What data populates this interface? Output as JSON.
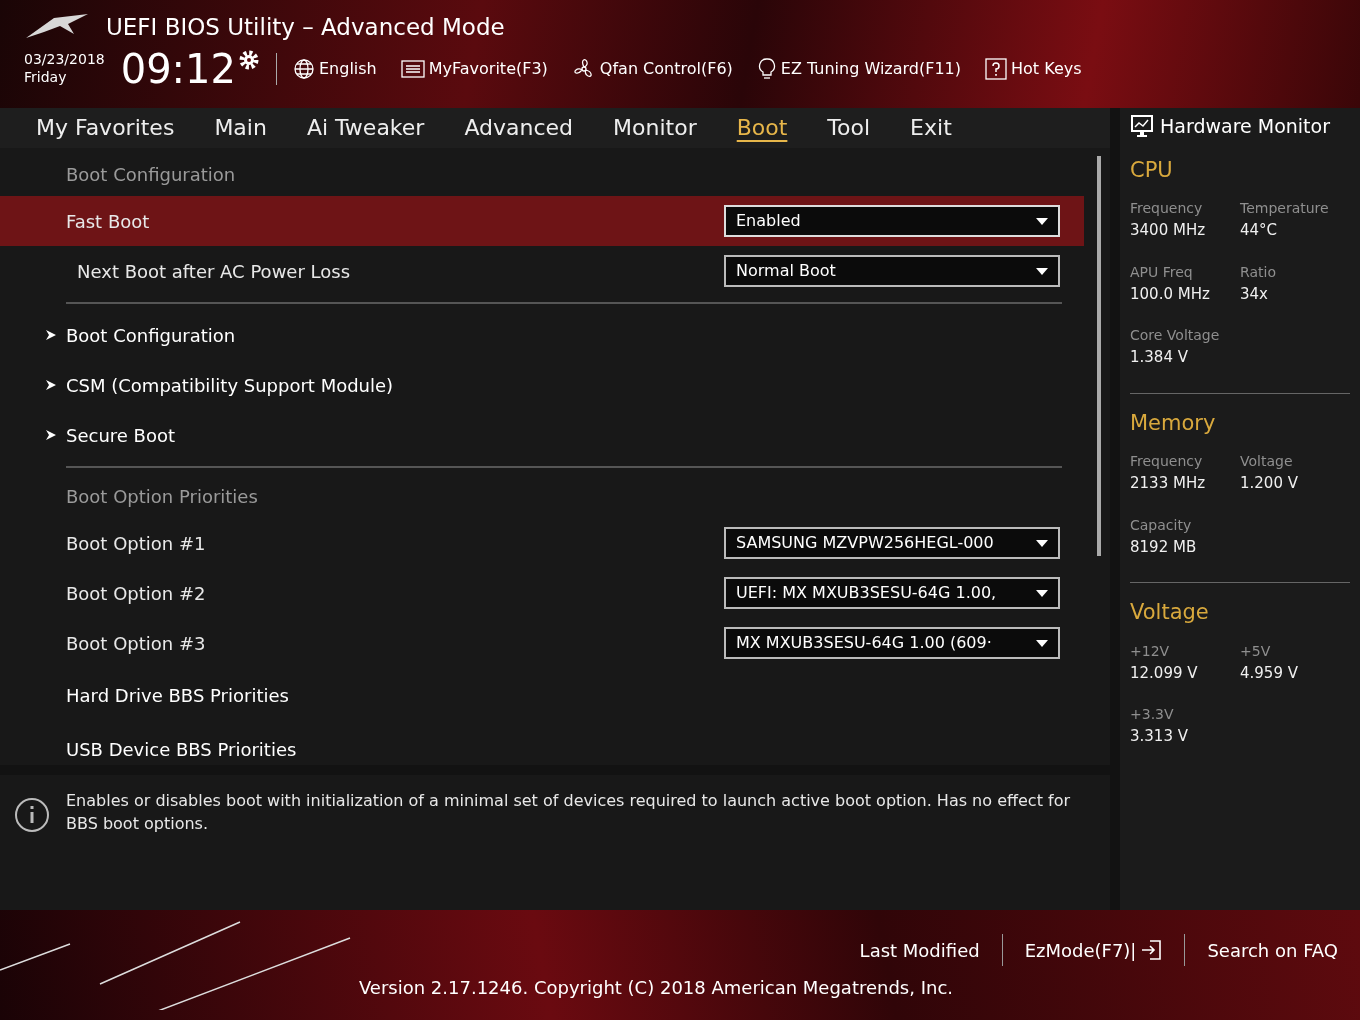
{
  "window": {
    "title": "UEFI BIOS Utility – Advanced Mode"
  },
  "header": {
    "date": "03/23/2018",
    "day": "Friday",
    "time": "09:12",
    "tools": [
      {
        "label": "English"
      },
      {
        "label": "MyFavorite(F3)"
      },
      {
        "label": "Qfan Control(F6)"
      },
      {
        "label": "EZ Tuning Wizard(F11)"
      },
      {
        "label": "Hot Keys"
      }
    ]
  },
  "tabs": [
    {
      "label": "My Favorites",
      "selected": false
    },
    {
      "label": "Main",
      "selected": false
    },
    {
      "label": "Ai Tweaker",
      "selected": false
    },
    {
      "label": "Advanced",
      "selected": false
    },
    {
      "label": "Monitor",
      "selected": false
    },
    {
      "label": "Boot",
      "selected": true
    },
    {
      "label": "Tool",
      "selected": false
    },
    {
      "label": "Exit",
      "selected": false
    }
  ],
  "items": [
    {
      "kind": "heading",
      "label": "Boot Configuration"
    },
    {
      "kind": "setting",
      "label": "Fast Boot",
      "value": "Enabled",
      "selected": true
    },
    {
      "kind": "setting",
      "label": "Next Boot after AC Power Loss",
      "value": "Normal Boot",
      "selected": false
    },
    {
      "kind": "divider"
    },
    {
      "kind": "submenu",
      "label": "Boot Configuration"
    },
    {
      "kind": "submenu",
      "label": "CSM (Compatibility Support Module)"
    },
    {
      "kind": "submenu",
      "label": "Secure Boot"
    },
    {
      "kind": "divider"
    },
    {
      "kind": "heading",
      "label": "Boot Option Priorities"
    },
    {
      "kind": "setting",
      "label": "Boot Option #1",
      "value": "SAMSUNG MZVPW256HEGL-000",
      "selected": false
    },
    {
      "kind": "setting",
      "label": "Boot Option #2",
      "value": "UEFI: MX MXUB3SESU-64G 1.00,",
      "selected": false
    },
    {
      "kind": "setting",
      "label": "Boot Option #3",
      "value": "MX MXUB3SESU-64G 1.00  (609·",
      "selected": false
    },
    {
      "kind": "link",
      "label": "Hard Drive BBS Priorities"
    },
    {
      "kind": "link",
      "label": "USB Device BBS Priorities"
    }
  ],
  "help": {
    "text": "Enables or disables boot with initialization of a minimal set of devices required to launch active boot option. Has no effect for BBS boot options."
  },
  "monitor": {
    "title": "Hardware Monitor",
    "sections": [
      {
        "title": "CPU",
        "readings": [
          {
            "label": "Frequency",
            "value": "3400 MHz"
          },
          {
            "label": "Temperature",
            "value": "44°C"
          },
          {
            "label": "APU Freq",
            "value": "100.0 MHz"
          },
          {
            "label": "Ratio",
            "value": "34x"
          },
          {
            "label": "Core Voltage",
            "value": "1.384 V"
          }
        ]
      },
      {
        "title": "Memory",
        "readings": [
          {
            "label": "Frequency",
            "value": "2133 MHz"
          },
          {
            "label": "Voltage",
            "value": "1.200 V"
          },
          {
            "label": "Capacity",
            "value": "8192 MB"
          }
        ]
      },
      {
        "title": "Voltage",
        "readings": [
          {
            "label": "+12V",
            "value": "12.099 V"
          },
          {
            "label": "+5V",
            "value": "4.959 V"
          },
          {
            "label": "+3.3V",
            "value": "3.313 V"
          }
        ]
      }
    ]
  },
  "footer": {
    "links": [
      {
        "label": "Last Modified",
        "icon": false
      },
      {
        "label": "EzMode(F7)|",
        "icon": true
      },
      {
        "label": "Search on FAQ",
        "icon": false
      }
    ],
    "version": "Version 2.17.1246. Copyright (C) 2018 American Megatrends, Inc."
  }
}
